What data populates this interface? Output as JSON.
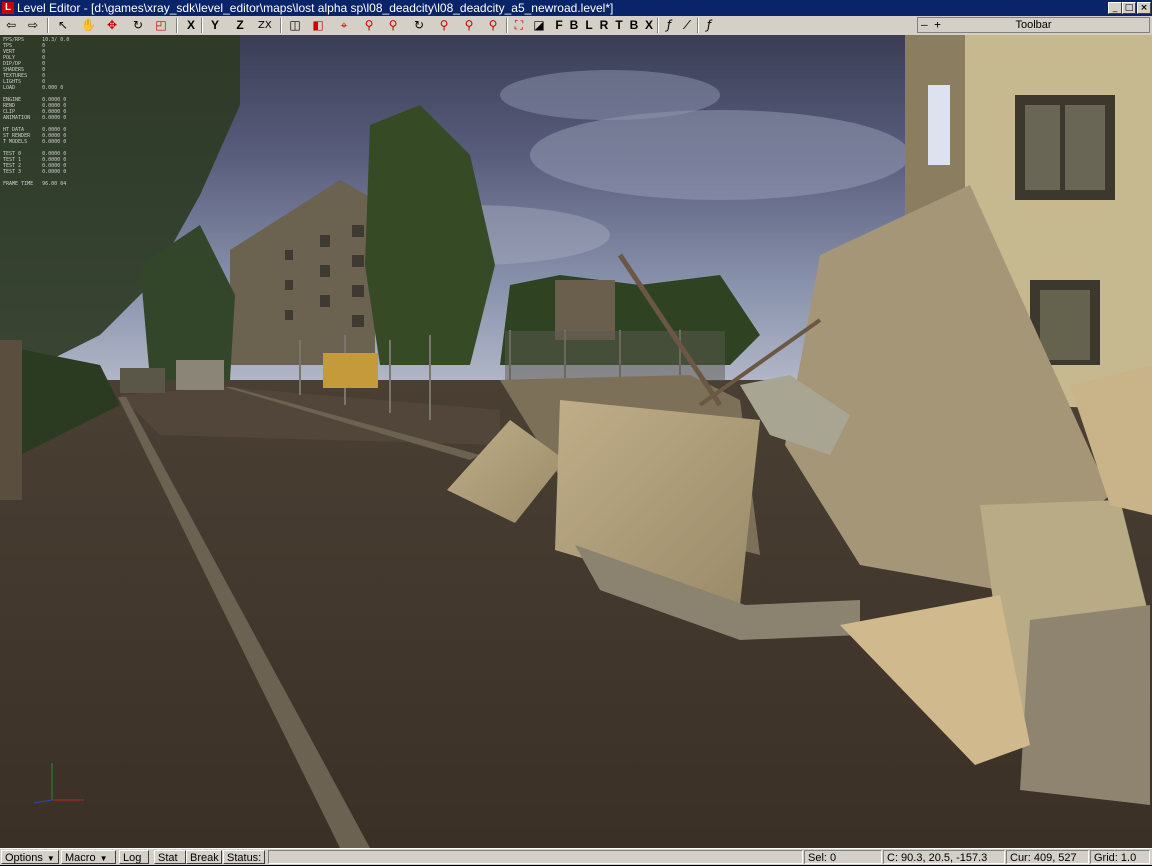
{
  "window": {
    "title": "Level Editor - [d:\\games\\xray_sdk\\level_editor\\maps\\lost alpha sp\\l08_deadcity\\l08_deadcity_a5_newroad.level*]",
    "app_icon": "L",
    "minimize": "_",
    "maximize": "□",
    "close": "×"
  },
  "toolbar": {
    "icons": [
      "undo-arrow-icon",
      "redo-arrow-icon",
      "select-cursor-icon",
      "move-hand-icon",
      "move-arrows-icon",
      "rotate-icon",
      "scale-icon"
    ],
    "axis_x": "X",
    "axis_y": "Y",
    "axis_z": "Z",
    "axis_zx": "ZX",
    "snap_letters": [
      "F",
      "B",
      "L",
      "R",
      "T",
      "B",
      "X"
    ],
    "panel_controls": "–  +",
    "panel_label": "Toolbar"
  },
  "viewport": {
    "stats_text": "FPS/RPS      10.3/ 0.0\nTPS          0\nVERT         0\nPOLY         0\nDIP/DP       0\nSHADERS      0\nTEXTURES     0\nLIGHTS       0\nLOAD         0.000 0\n\nENGINE       0.0000 0\nREND         0.0000 0\nCLIP         0.0000 0\nANIMATION    0.0000 0\n\nHT DATA      0.0000 0\nST RENDER    0.0000 0\nT MODELS     0.0000 0\n\nTEST 0       0.0000 0\nTEST 1       0.0000 0\nTEST 2       0.0000 0\nTEST 3       0.0000 0\n\nFRAME TIME   96.00 04"
  },
  "statusbar": {
    "options": "Options",
    "macro": "Macro",
    "log": "Log",
    "stat": "Stat",
    "break": "Break",
    "status": "Status:",
    "sel": "Sel: 0",
    "coords": "C: 90.3, 20.5, -157.3",
    "cursor": "Cur: 409, 527",
    "grid": "Grid: 1.0"
  }
}
